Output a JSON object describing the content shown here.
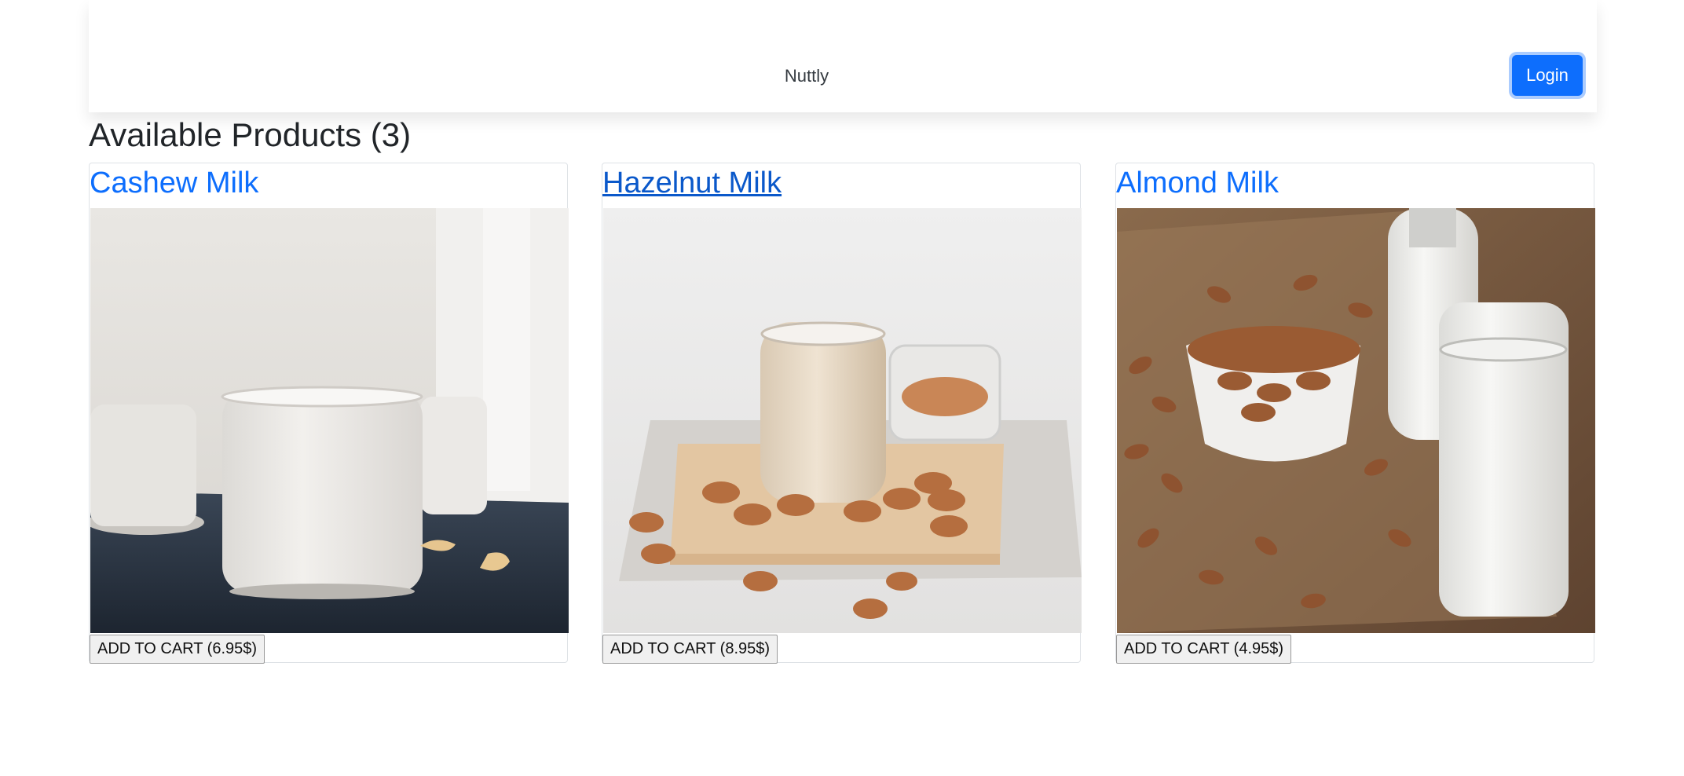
{
  "navbar": {
    "brand": "Nuttly",
    "login_label": "Login"
  },
  "main": {
    "title": "Available Products (3)",
    "products": [
      {
        "name": "Cashew Milk",
        "image_icon": "cashew-milk-image",
        "cart_label": "ADD TO CART (6.95$)"
      },
      {
        "name": "Hazelnut Milk",
        "image_icon": "hazelnut-milk-image",
        "cart_label": "ADD TO CART (8.95$)"
      },
      {
        "name": "Almond Milk",
        "image_icon": "almond-milk-image",
        "cart_label": "ADD TO CART (4.95$)"
      }
    ]
  },
  "colors": {
    "primary": "#0d6efd",
    "link_hover": "#0a58ca"
  }
}
